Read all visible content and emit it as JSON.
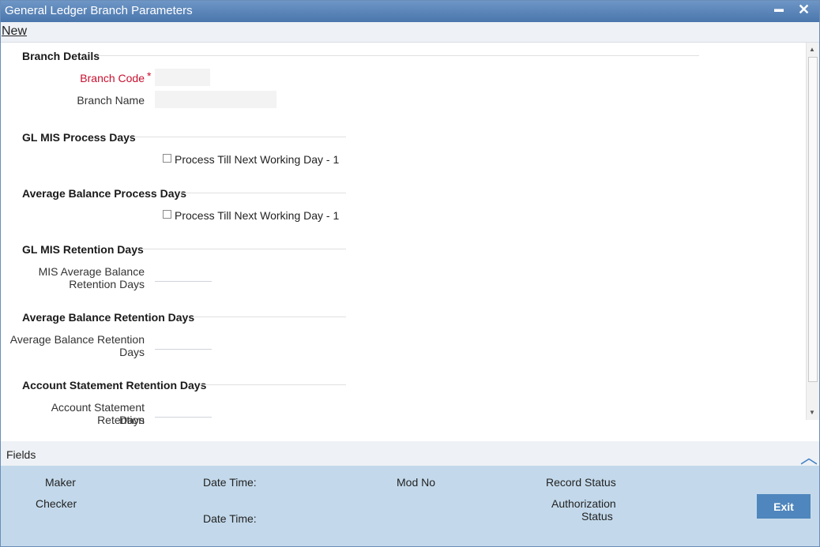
{
  "window": {
    "title": "General Ledger Branch Parameters",
    "minimize_glyph": "▬",
    "close_glyph": "✕"
  },
  "menu": {
    "new_label": "New"
  },
  "sections": {
    "branch_details": {
      "title": "Branch Details",
      "branch_code_label": "Branch Code",
      "required_marker": "*",
      "branch_name_label": "Branch Name",
      "branch_code_value": "",
      "branch_name_value": ""
    },
    "gl_mis_process": {
      "title": "GL MIS Process Days",
      "checkbox_label": "Process Till Next Working Day - 1",
      "checked": false
    },
    "avg_balance_process": {
      "title": "Average Balance Process Days",
      "checkbox_label": "Process Till Next Working Day - 1",
      "checked": false
    },
    "gl_mis_retention": {
      "title": "GL MIS Retention Days",
      "label_line1": "MIS Average Balance",
      "label_line2": "Retention Days",
      "value": ""
    },
    "avg_balance_retention": {
      "title": "Average Balance Retention Days",
      "label_line1": "Average Balance Retention",
      "label_line2": "Days",
      "value": ""
    },
    "acct_stmt_retention": {
      "title": "Account Statement Retention Days",
      "label_line1": "Account Statement Retention",
      "label_line2": "Days",
      "value": ""
    }
  },
  "fields_bar": {
    "label": "Fields"
  },
  "footer": {
    "maker": "Maker",
    "checker": "Checker",
    "date_time_1": "Date Time:",
    "date_time_2": "Date Time:",
    "mod_no": "Mod No",
    "record_status": "Record Status",
    "auth_status_line1": "Authorization",
    "auth_status_line2": "Status",
    "exit_label": "Exit"
  },
  "colors": {
    "title_bar": "#4a76ad",
    "required_label": "#c8102e",
    "footer_bg": "#c3d9eb",
    "exit_button": "#4f86bd"
  }
}
